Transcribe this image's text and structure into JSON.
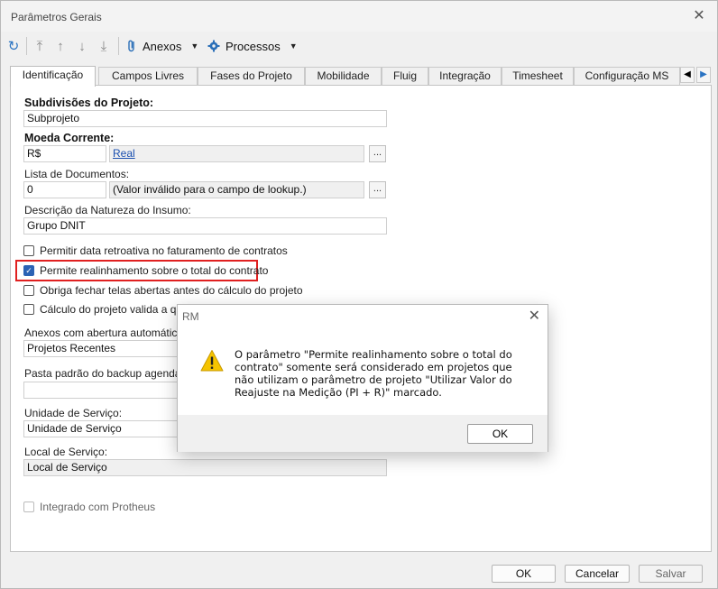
{
  "window": {
    "title": "Parâmetros Gerais",
    "close_glyph": "✕"
  },
  "toolbar": {
    "refresh_icon": "↻",
    "first_icon": "⤒",
    "up_icon": "↑",
    "down_icon": "↓",
    "last_icon": "⤓",
    "anexos_label": "Anexos",
    "processos_label": "Processos",
    "dropdown_glyph": "▼"
  },
  "tabs": [
    {
      "label": "Identificação"
    },
    {
      "label": "Campos Livres"
    },
    {
      "label": "Fases do Projeto"
    },
    {
      "label": "Mobilidade"
    },
    {
      "label": "Fluig"
    },
    {
      "label": "Integração"
    },
    {
      "label": "Timesheet"
    },
    {
      "label": "Configuração MS"
    }
  ],
  "tab_nav": {
    "prev": "◀",
    "next": "▶"
  },
  "form": {
    "subdivisoes_label": "Subdivisões do Projeto:",
    "subdivisoes_value": "Subprojeto",
    "moeda_label": "Moeda Corrente:",
    "moeda_code": "R$",
    "moeda_name": "Real",
    "lista_docs_label": "Lista de Documentos:",
    "lista_docs_code": "0",
    "lista_docs_desc": "(Valor inválido para o campo de lookup.)",
    "descricao_label": "Descrição da Natureza do Insumo:",
    "descricao_value": "Grupo DNIT",
    "ellipsis": "...",
    "chk_retroativa": "Permitir data retroativa no faturamento de contratos",
    "chk_realinhamento": "Permite realinhamento sobre o total do contrato",
    "chk_fechar_telas": "Obriga fechar telas abertas antes do cálculo do projeto",
    "chk_calculo": "Cálculo do projeto valida a quan",
    "anexos_label": "Anexos com abertura automática na",
    "anexos_value": "Projetos Recentes",
    "pasta_label": "Pasta padrão do backup agendado:",
    "pasta_value": "",
    "unidade_label": "Unidade de Serviço:",
    "unidade_value": "Unidade de Serviço",
    "local_label": "Local de Serviço:",
    "local_value": "Local de Serviço",
    "chk_protheus": "Integrado com Protheus",
    "checkmark": "✓"
  },
  "footer": {
    "ok": "OK",
    "cancel": "Cancelar",
    "save": "Salvar"
  },
  "dialog": {
    "title": "RM",
    "close_glyph": "✕",
    "message": "O parâmetro \"Permite realinhamento sobre o total do contrato\" somente será considerado em projetos que não utilizam o parâmetro de projeto \"Utilizar Valor do Reajuste na Medição (PI + R)\" marcado.",
    "ok": "OK"
  },
  "colors": {
    "accent": "#2b63b5",
    "highlight_border": "#e02020",
    "warning_yellow": "#f5c400"
  }
}
